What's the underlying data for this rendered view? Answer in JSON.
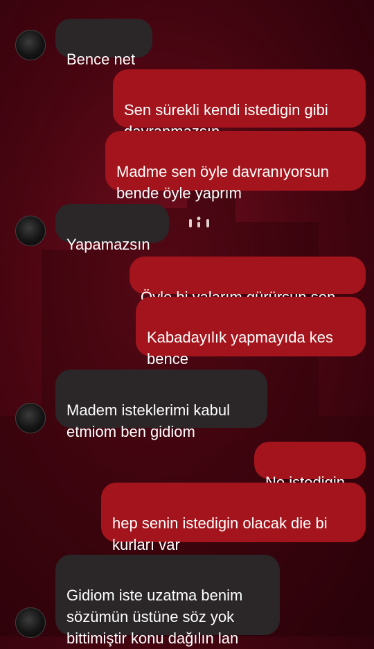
{
  "messages": [
    {
      "side": "in",
      "text": "Bence net"
    },
    {
      "side": "out",
      "text": "Sen sürekli kendi istedigin gibi\ndavranmazsın"
    },
    {
      "side": "out",
      "text": "Madme sen öyle davranıyorsun\nbende öyle yaprım"
    },
    {
      "side": "in",
      "text": "Yapamazsın"
    },
    {
      "side": "out",
      "text": "Öyle bi yalarım gürürsun sen"
    },
    {
      "side": "out",
      "text": "Kabadayılık yapmayıda kes\nbence"
    },
    {
      "side": "in",
      "text": "Madem isteklerimi kabul\netmiom ben gidiom"
    },
    {
      "side": "out",
      "text": "Ne istedigin"
    },
    {
      "side": "out",
      "text": "hep senin istedigin olacak die bi\nkurları var"
    },
    {
      "side": "in",
      "text": "Gidiom iste uzatma benim\nsözümün üstüne söz yok\nbittimiştir konu dağılın lan"
    }
  ],
  "colors": {
    "incoming_bubble": "#2b2628",
    "outgoing_bubble": "#a3141c",
    "background": "#4a0612"
  },
  "icons": {
    "avatar": "contact-avatar",
    "reaction": "more-options-icon"
  }
}
